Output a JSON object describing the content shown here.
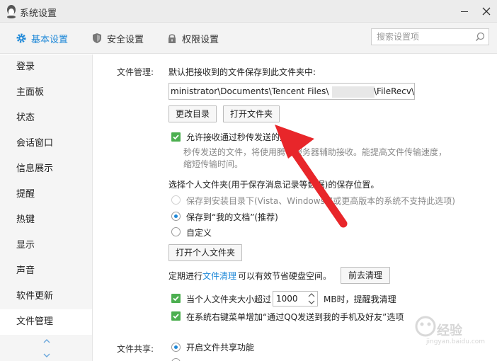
{
  "window": {
    "title": "系统设置"
  },
  "tabs": [
    {
      "label": "基本设置",
      "icon": "gear-icon",
      "active": true
    },
    {
      "label": "安全设置",
      "icon": "shield-icon",
      "active": false
    },
    {
      "label": "权限设置",
      "icon": "lock-icon",
      "active": false
    }
  ],
  "search": {
    "placeholder": "搜索设置项"
  },
  "sidebar": {
    "items": [
      {
        "label": "登录"
      },
      {
        "label": "主面板"
      },
      {
        "label": "状态"
      },
      {
        "label": "会话窗口"
      },
      {
        "label": "信息展示"
      },
      {
        "label": "提醒"
      },
      {
        "label": "热键"
      },
      {
        "label": "显示"
      },
      {
        "label": "声音"
      },
      {
        "label": "软件更新"
      },
      {
        "label": "文件管理",
        "active": true
      }
    ]
  },
  "file_mgmt": {
    "section_label": "文件管理:",
    "save_location_desc": "默认把接收到的文件保存到此文件夹中:",
    "path_left": "ministrator\\Documents\\Tencent Files\\",
    "path_right": "\\FileRecv\\",
    "change_dir_btn": "更改目录",
    "open_folder_btn": "打开文件夹",
    "allow_flash_transfer": "允许接收通过秒传发送的文件",
    "flash_note_line1": "秒传发送的文件，将使用腾讯服务器辅助接收。能提高文件传输速度，",
    "flash_note_line2": "缩短传输时间。",
    "personal_folder_desc": "选择个人文件夹(用于保存消息记录等数据)的保存位置。",
    "opt_install_dir": "保存到安装目录下(Vista、Windows 7或更高版本的系统不支持此选项)",
    "opt_my_docs": "保存到“我的文档”(推荐)",
    "opt_custom": "自定义",
    "open_personal_btn": "打开个人文件夹",
    "cleanup_prefix": "定期进行",
    "cleanup_link": "文件清理",
    "cleanup_suffix": "可以有效节省硬盘空间。",
    "goto_cleanup_btn": "前去清理",
    "size_warn_prefix": "当个人文件夹大小超过",
    "size_value": "1000",
    "size_warn_suffix": "MB时，提醒我清理",
    "context_menu": "在系统右键菜单增加“通过QQ发送到我的手机及好友”选项"
  },
  "file_share": {
    "section_label": "文件共享:",
    "enable_share": "开启文件共享功能"
  },
  "watermark": {
    "text": "经验",
    "sub": "jingyan.baidu.com"
  },
  "colors": {
    "accent": "#1e88d8",
    "check": "#4caf50",
    "arrow": "#e8262a"
  }
}
